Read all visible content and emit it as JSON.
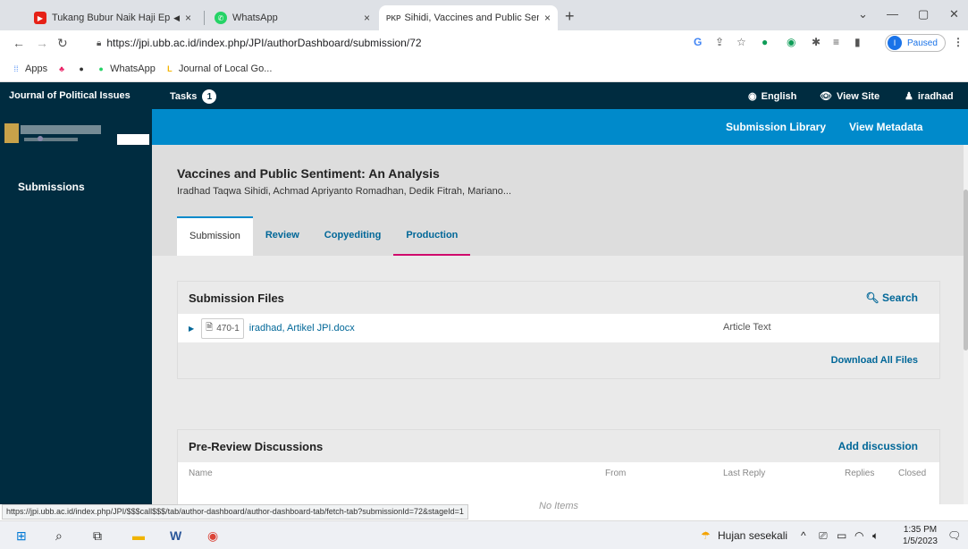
{
  "browser": {
    "tabs": [
      {
        "title": "Tukang Bubur Naik Haji Eps",
        "mute": "◀",
        "close": "×"
      },
      {
        "title": "WhatsApp",
        "close": "×"
      },
      {
        "title": "Sihidi, Vaccines and Public Sentin",
        "favicon_text": "PKP",
        "close": "×"
      }
    ],
    "new_tab": "+",
    "window_controls": {
      "minimize": "—",
      "maximize": "▢",
      "close": "✕",
      "tabsearch": "⌄"
    },
    "url": "https://jpi.ubb.ac.id/index.php/JPI/authorDashboard/submission/72",
    "profile": {
      "initial": "I",
      "status": "Paused"
    },
    "bookmarks": [
      "Apps",
      "WhatsApp",
      "Journal of Local Go..."
    ]
  },
  "app": {
    "journal_name": "Journal of Political Issues",
    "tasks_label": "Tasks",
    "tasks_count": "1",
    "language": "English",
    "view_site": "View Site",
    "username": "iradhad",
    "sidebar_item": "Submissions",
    "submission_library": "Submission Library",
    "view_metadata": "View Metadata"
  },
  "submission": {
    "title": "Vaccines and Public Sentiment: An Analysis",
    "authors": "Iradhad Taqwa Sihidi, Achmad Apriyanto Romadhan, Dedik Fitrah, Mariano..."
  },
  "workflow_tabs": [
    "Submission",
    "Review",
    "Copyediting",
    "Production"
  ],
  "files_panel": {
    "title": "Submission Files",
    "search": "Search",
    "file_id": "470-1",
    "file_name": "iradhad, Artikel JPI.docx",
    "file_type": "Article Text",
    "download_all": "Download All Files"
  },
  "discussions_panel": {
    "title": "Pre-Review Discussions",
    "add": "Add discussion",
    "columns": [
      "Name",
      "From",
      "Last Reply",
      "Replies",
      "Closed"
    ],
    "empty": "No Items"
  },
  "status_url": "https://jpi.ubb.ac.id/index.php/JPI/$$$call$$$/tab/author-dashboard/author-dashboard-tab/fetch-tab?submissionId=72&stageId=1",
  "taskbar": {
    "weather": "Hujan sesekali",
    "time": "1:35 PM",
    "date": "1/5/2023"
  }
}
